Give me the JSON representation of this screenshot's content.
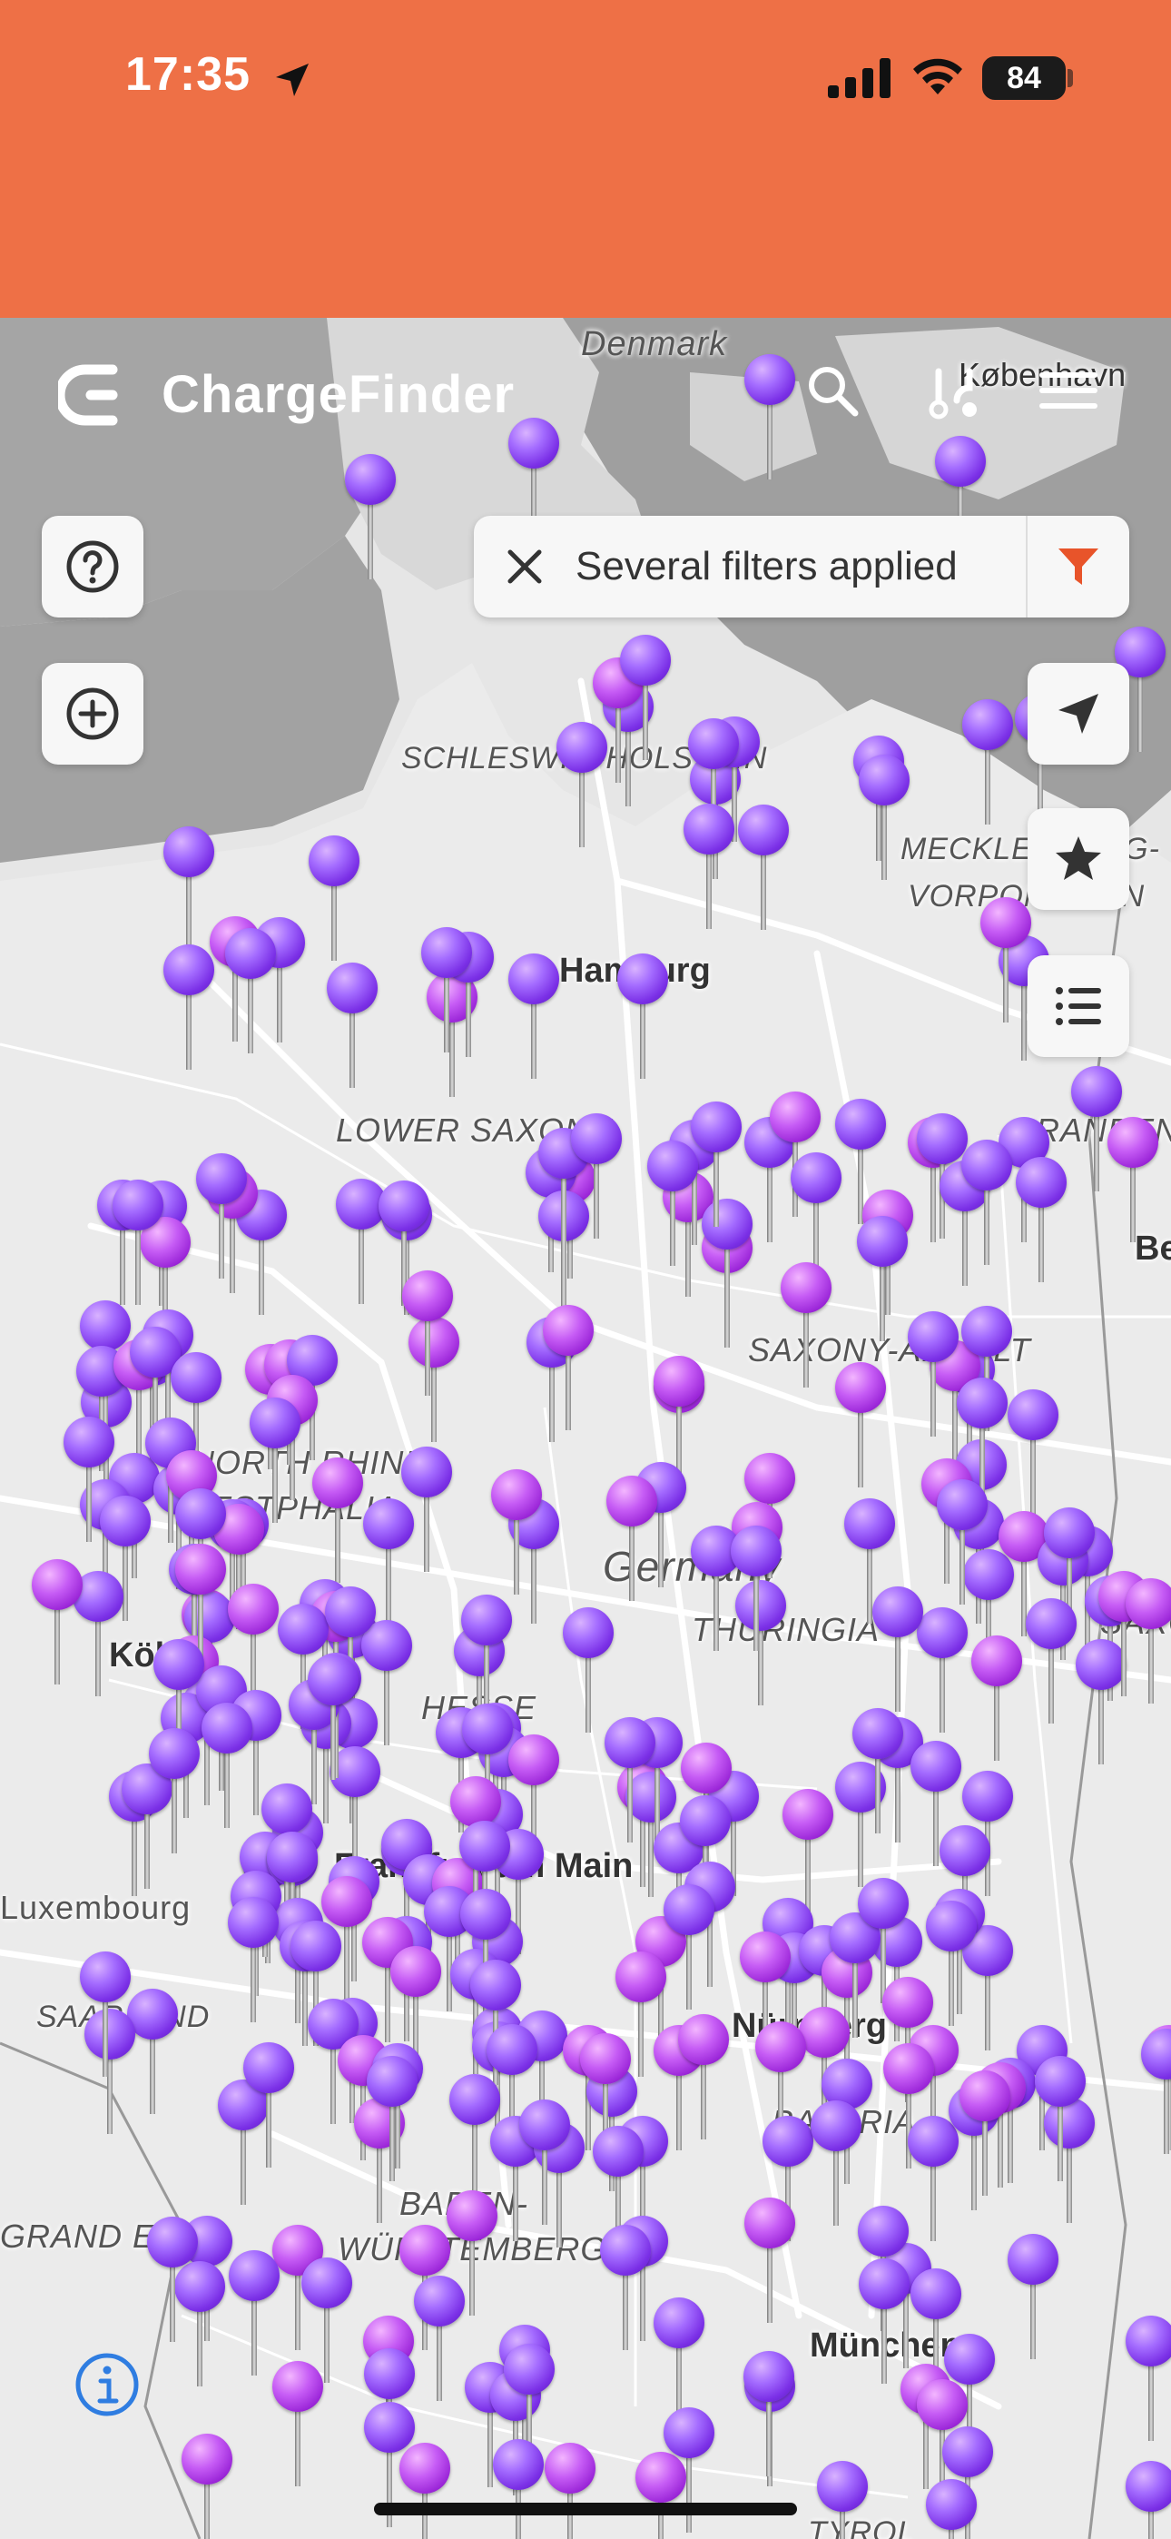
{
  "status_bar": {
    "time": "17:35",
    "battery": "84"
  },
  "app_bar": {
    "title": "ChargeFinder",
    "icons": [
      "search-icon",
      "route-icon",
      "menu-icon"
    ]
  },
  "filters": {
    "label": "Several filters applied"
  },
  "map": {
    "labels": {
      "denmark": "Denmark",
      "kobenhavn": "København",
      "schleswig": "SCHLESWIG-HOLSTEIN",
      "meckl1": "MECKLENBURG-",
      "meckl2": "VORPOMMERN",
      "hamburg": "Hamburg",
      "lower_saxony": "LOWER SAXONY",
      "brandenburg": "BRANDENBURG",
      "berlin": "Berlin",
      "saxony_anhalt": "SAXONY-ANHALT",
      "nrw1": "NORTH RHINE-",
      "nrw2": "WESTPHALIA",
      "germany": "Germany",
      "thuringia": "THURINGIA",
      "saxony": "SAXONY",
      "koln": "Köln",
      "hesse": "HESSE",
      "frankfurt": "Frankfurt am Main",
      "luxembourg": "Luxembourg",
      "saarland": "SAARLAND",
      "nurnberg": "Nürnberg",
      "bavaria": "BAVARIA",
      "bw1": "BADEN-",
      "bw2": "WÜRTTEMBERG",
      "grand_est": "GRAND EST",
      "munchen": "München",
      "tyrol": "TYROL"
    }
  },
  "colors": {
    "brand": "#EE7046",
    "pin": "#8B3DF0",
    "filter_icon": "#E8542A"
  }
}
